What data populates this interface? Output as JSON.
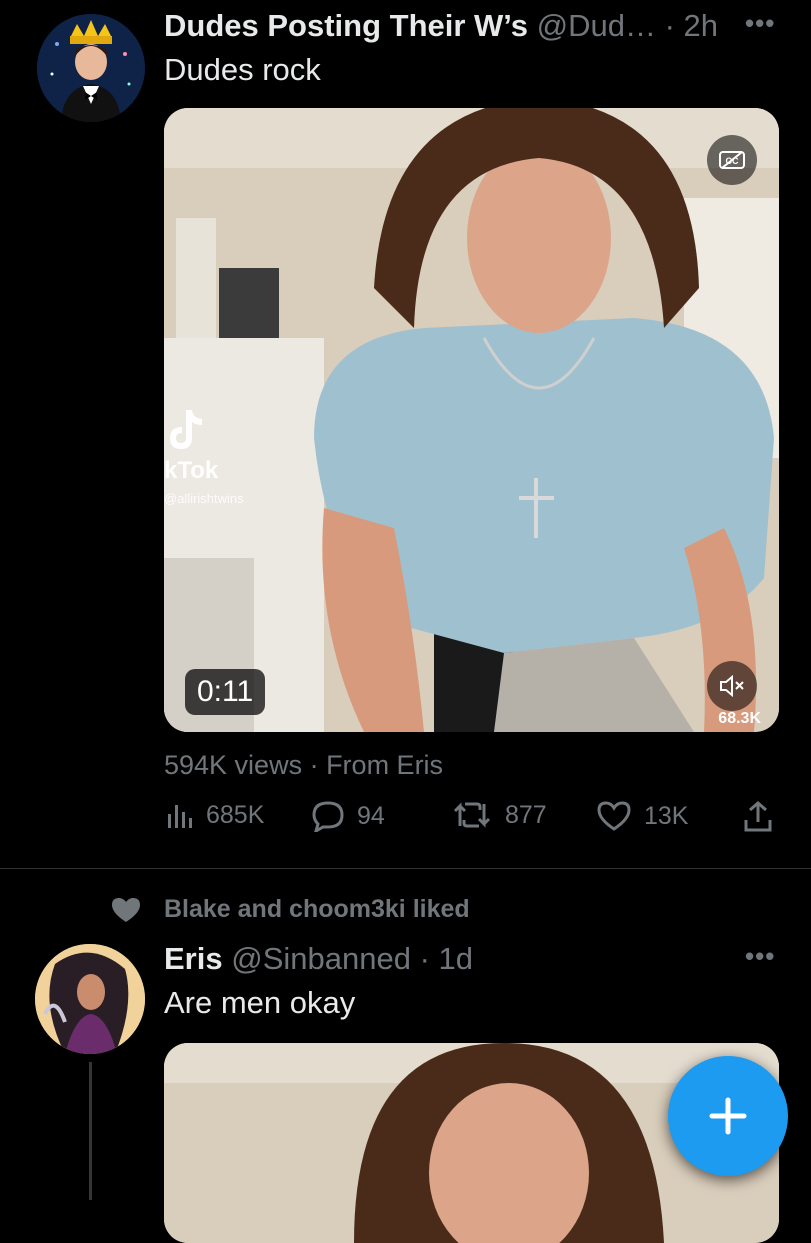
{
  "tweet1": {
    "display_name": "Dudes Posting Their W’s",
    "handle_time": "@Dud… · 2h",
    "text": "Dudes rock",
    "video": {
      "duration": "0:11",
      "watermark_brand": "kTok",
      "watermark_handle": "@allirishtwins",
      "overlay_count": "68.3K",
      "cc_label": "CC"
    },
    "views_line": "594K views · From Eris",
    "actions": {
      "views": "685K",
      "replies": "94",
      "retweets": "877",
      "likes": "13K"
    }
  },
  "social_context": "Blake and choom3ki liked",
  "tweet2": {
    "display_name": "Eris",
    "handle_time": "@Sinbanned · 1d",
    "text": "Are men okay"
  },
  "colors": {
    "background": "#000000",
    "text": "#e7e9ea",
    "secondary": "#71767b",
    "accent": "#1d9bf0"
  }
}
